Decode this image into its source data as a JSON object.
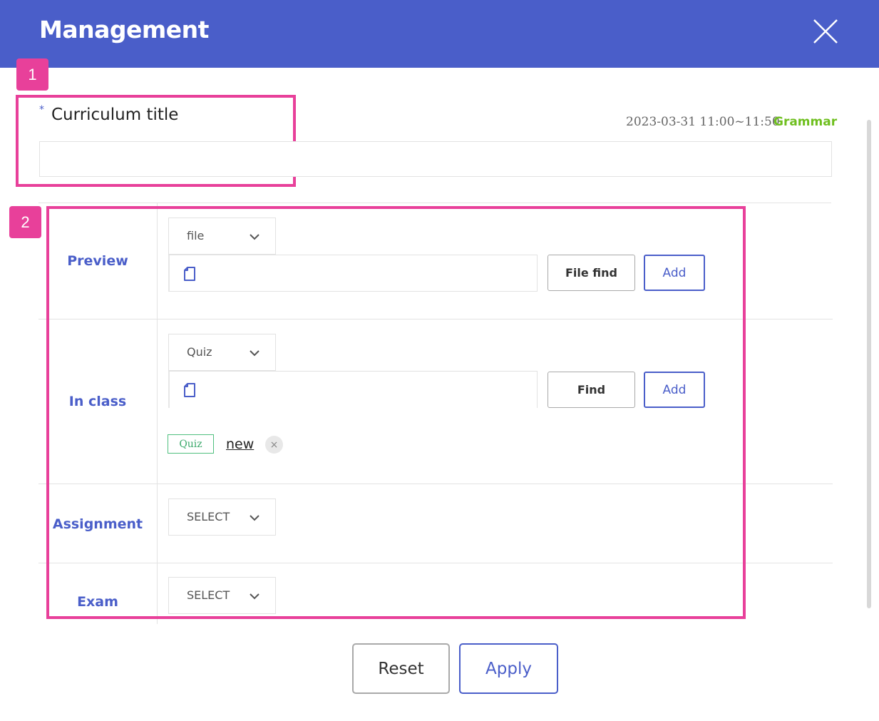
{
  "header": {
    "title": "Management",
    "close_icon": "close-icon"
  },
  "annotations": {
    "badge_1": "1",
    "badge_2": "2"
  },
  "title_section": {
    "required_mark": "*",
    "label": "Curriculum title",
    "datetime": "2023-03-31 11:00~11:50",
    "subject": "Grammar",
    "input_value": ""
  },
  "rows": {
    "preview": {
      "label": "Preview",
      "select_value": "file",
      "find_label": "File find",
      "add_label": "Add"
    },
    "in_class": {
      "label": "In class",
      "select_value": "Quiz",
      "find_label": "Find",
      "add_label": "Add",
      "attached": {
        "tag": "Quiz",
        "name": "new",
        "remove": "×"
      }
    },
    "assignment": {
      "label": "Assignment",
      "select_value": "SELECT"
    },
    "exam": {
      "label": "Exam",
      "select_value": "SELECT"
    }
  },
  "footer": {
    "reset_label": "Reset",
    "apply_label": "Apply"
  },
  "colors": {
    "header_bg": "#4a5ec9",
    "accent": "#4a5ec9",
    "highlight": "#e8409a",
    "subject": "#6fbf1f",
    "tag": "#3aa86a"
  }
}
